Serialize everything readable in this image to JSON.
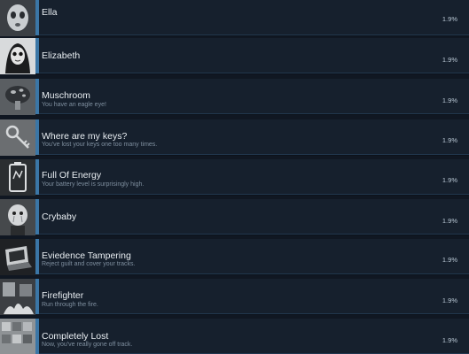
{
  "achievements": [
    {
      "title": "Ella",
      "description": "",
      "percent": "1.9%",
      "icon": "ghost-face-icon"
    },
    {
      "title": "Elizabeth",
      "description": "",
      "percent": "1.9%",
      "icon": "girl-face-icon"
    },
    {
      "title": "Muschroom",
      "description": "You have an eagle eye!",
      "percent": "1.9%",
      "icon": "mushroom-icon"
    },
    {
      "title": "Where are my keys?",
      "description": "You've lost your keys one too many times.",
      "percent": "1.9%",
      "icon": "keys-icon"
    },
    {
      "title": "Full Of Energy",
      "description": "Your battery level is surprisingly high.",
      "percent": "1.9%",
      "icon": "battery-hand-icon"
    },
    {
      "title": "Crybaby",
      "description": "",
      "percent": "1.9%",
      "icon": "crying-doll-icon"
    },
    {
      "title": "Eviedence Tampering",
      "description": "Reject guilt and cover your tracks.",
      "percent": "1.9%",
      "icon": "laptop-icon"
    },
    {
      "title": "Firefighter",
      "description": "Run through the fire.",
      "percent": "1.9%",
      "icon": "fire-room-icon"
    },
    {
      "title": "Completely Lost",
      "description": "Now, you've really gone off track.",
      "percent": "1.9%",
      "icon": "lost-wall-icon"
    }
  ]
}
